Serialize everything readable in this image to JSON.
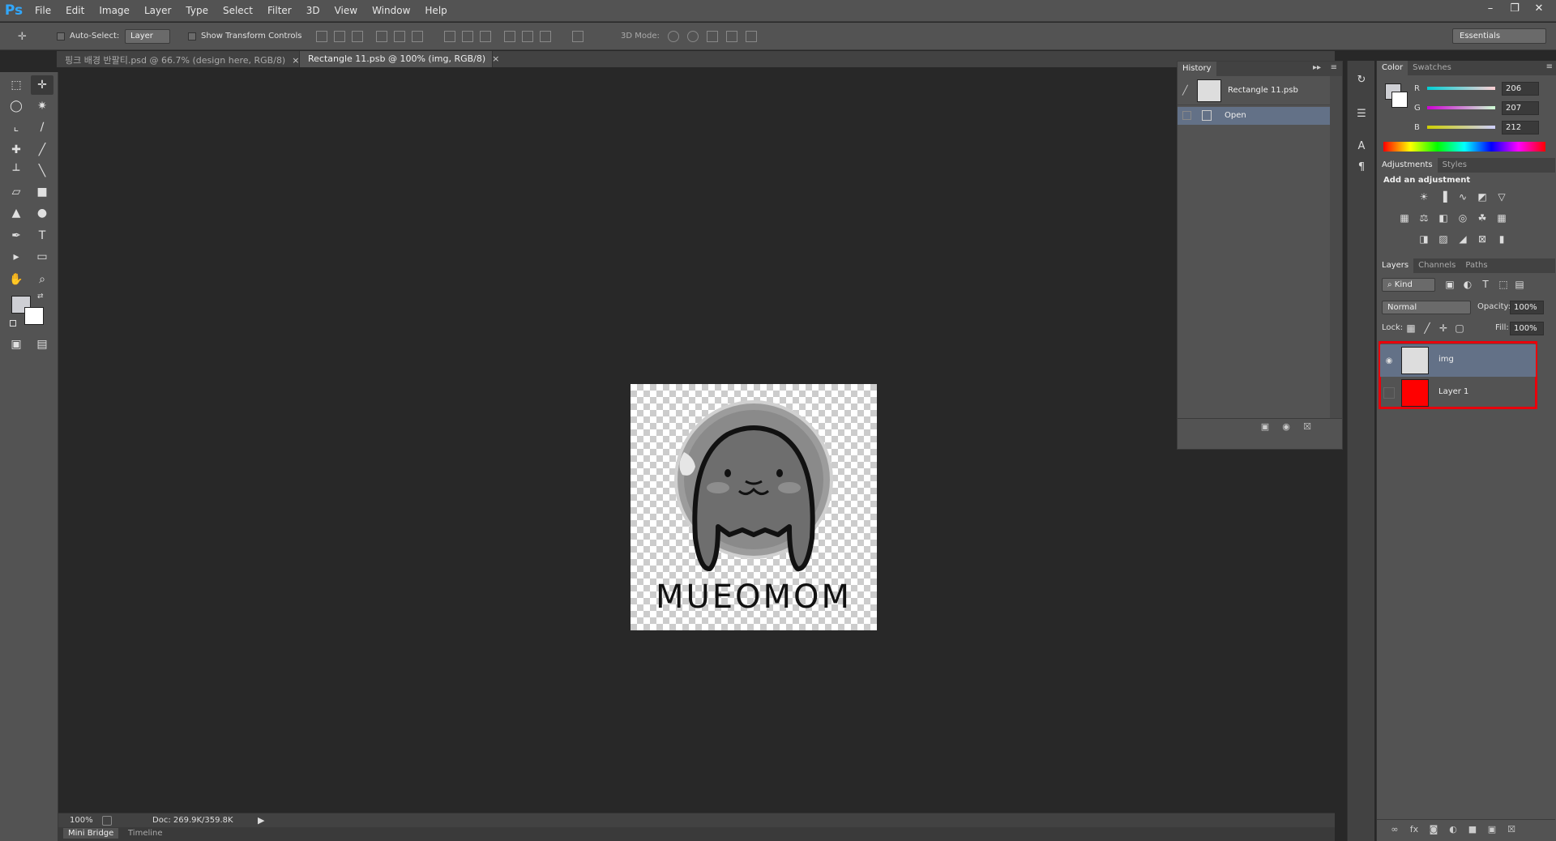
{
  "app": {
    "logo": "Ps"
  },
  "menu": [
    "File",
    "Edit",
    "Image",
    "Layer",
    "Type",
    "Select",
    "Filter",
    "3D",
    "View",
    "Window",
    "Help"
  ],
  "options": {
    "auto_select_label": "Auto-Select:",
    "auto_select_value": "Layer",
    "transform_label": "Show Transform Controls",
    "mode_3d_label": "3D Mode:",
    "workspace": "Essentials"
  },
  "tabs": [
    {
      "label": "핑크 배경 반팔티.psd @ 66.7% (design here, RGB/8)",
      "active": false
    },
    {
      "label": "Rectangle 11.psb @ 100% (img, RGB/8)",
      "active": true
    }
  ],
  "canvas": {
    "logo_text": "MUEOMOM"
  },
  "status": {
    "zoom": "100%",
    "doc": "Doc: 269.9K/359.8K"
  },
  "bottom_tabs": [
    "Mini Bridge",
    "Timeline"
  ],
  "history": {
    "title": "History",
    "snapshot": "Rectangle 11.psb",
    "states": [
      "Open"
    ]
  },
  "color_panel": {
    "tabs": [
      "Color",
      "Swatches"
    ],
    "r_label": "R",
    "g_label": "G",
    "b_label": "B",
    "r": "206",
    "g": "207",
    "b": "212",
    "foreground": "#cecfd4"
  },
  "adjustments": {
    "tabs": [
      "Adjustments",
      "Styles"
    ],
    "heading": "Add an adjustment"
  },
  "layers_panel": {
    "tabs": [
      "Layers",
      "Channels",
      "Paths"
    ],
    "filter": "Kind",
    "blend_mode": "Normal",
    "opacity_label": "Opacity:",
    "opacity": "100%",
    "lock_label": "Lock:",
    "fill_label": "Fill:",
    "fill": "100%",
    "layers": [
      {
        "name": "img",
        "selected": true,
        "visible": true
      },
      {
        "name": "Layer 1",
        "selected": false,
        "visible": false
      }
    ],
    "highlight_color": "#e8000b"
  }
}
